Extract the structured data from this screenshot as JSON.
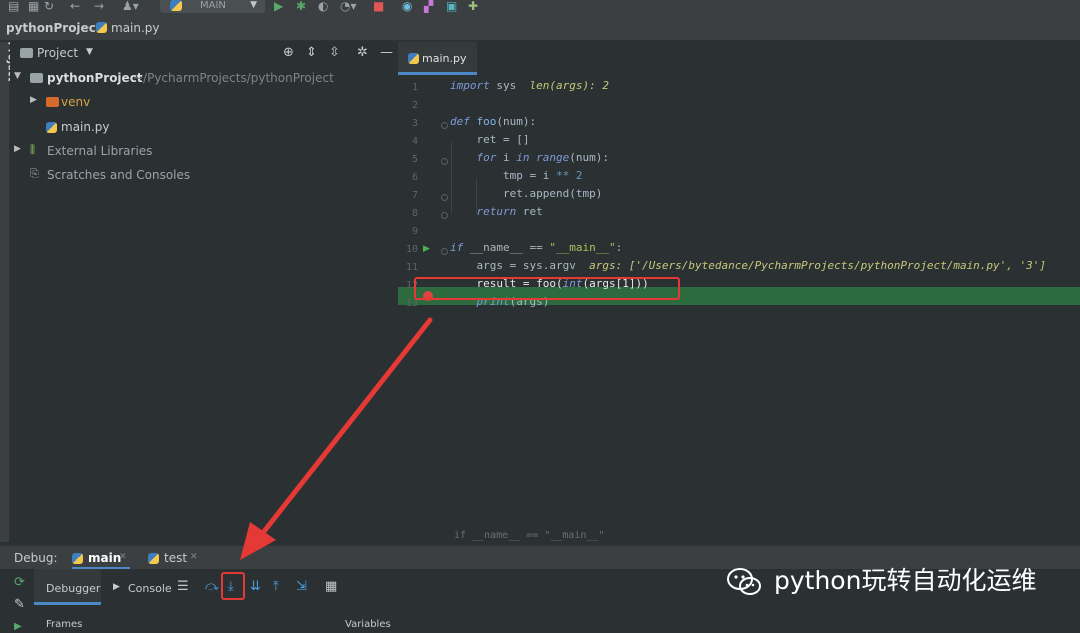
{
  "toolbar": {
    "run_config": "MAIN"
  },
  "navbar": {
    "project": "pythonProject",
    "file": "main.py"
  },
  "side_strip": {
    "label": "Project"
  },
  "project_panel": {
    "title": "Project",
    "root_name": "pythonProject",
    "root_path": "~/PycharmProjects/pythonProject",
    "items": [
      {
        "label": "venv"
      },
      {
        "label": "main.py"
      },
      {
        "label": "External Libraries"
      },
      {
        "label": "Scratches and Consoles"
      }
    ]
  },
  "editor": {
    "tab": "main.py",
    "line_numbers": [
      "1",
      "2",
      "3",
      "4",
      "5",
      "6",
      "7",
      "8",
      "9",
      "10",
      "11",
      "12",
      "13"
    ],
    "code": {
      "l1_kw": "import",
      "l1_rest": " sys  ",
      "l1_hint": "len(args): 2",
      "l3_kw": "def",
      "l3_fn": " foo",
      "l3_rest": "(num):",
      "l4": "    ret = []",
      "l5_kw": "    for",
      "l5_a": " i ",
      "l5_in": "in",
      "l5_b": " ",
      "l5_range": "range",
      "l5_c": "(num):",
      "l6_a": "        tmp = i ",
      "l6_op": "**",
      "l6_num": " 2",
      "l7": "        ret.append(tmp)",
      "l8_kw": "    return",
      "l8_rest": " ret",
      "l10_kw": "if",
      "l10_a": " __name__ == ",
      "l10_str": "\"__main__\"",
      "l10_b": ":",
      "l11_a": "    args = sys.argv  ",
      "l11_hint": "args: ['/Users/bytedance/PycharmProjects/pythonProject/main.py', '3']",
      "l12_a": "    result = foo(",
      "l12_int": "int",
      "l12_b": "(args[1]))",
      "l13_print": "    print",
      "l13_b": "(args)"
    },
    "breadcrumb": "if __name__ == \"__main__\""
  },
  "debug": {
    "label": "Debug:",
    "tabs": [
      {
        "label": "main"
      },
      {
        "label": "test"
      }
    ],
    "debugger_tab": "Debugger",
    "console_tab": "Console",
    "frames_label": "Frames",
    "variables_label": "Variables"
  },
  "watermark": {
    "text": "python玩转自动化运维"
  }
}
